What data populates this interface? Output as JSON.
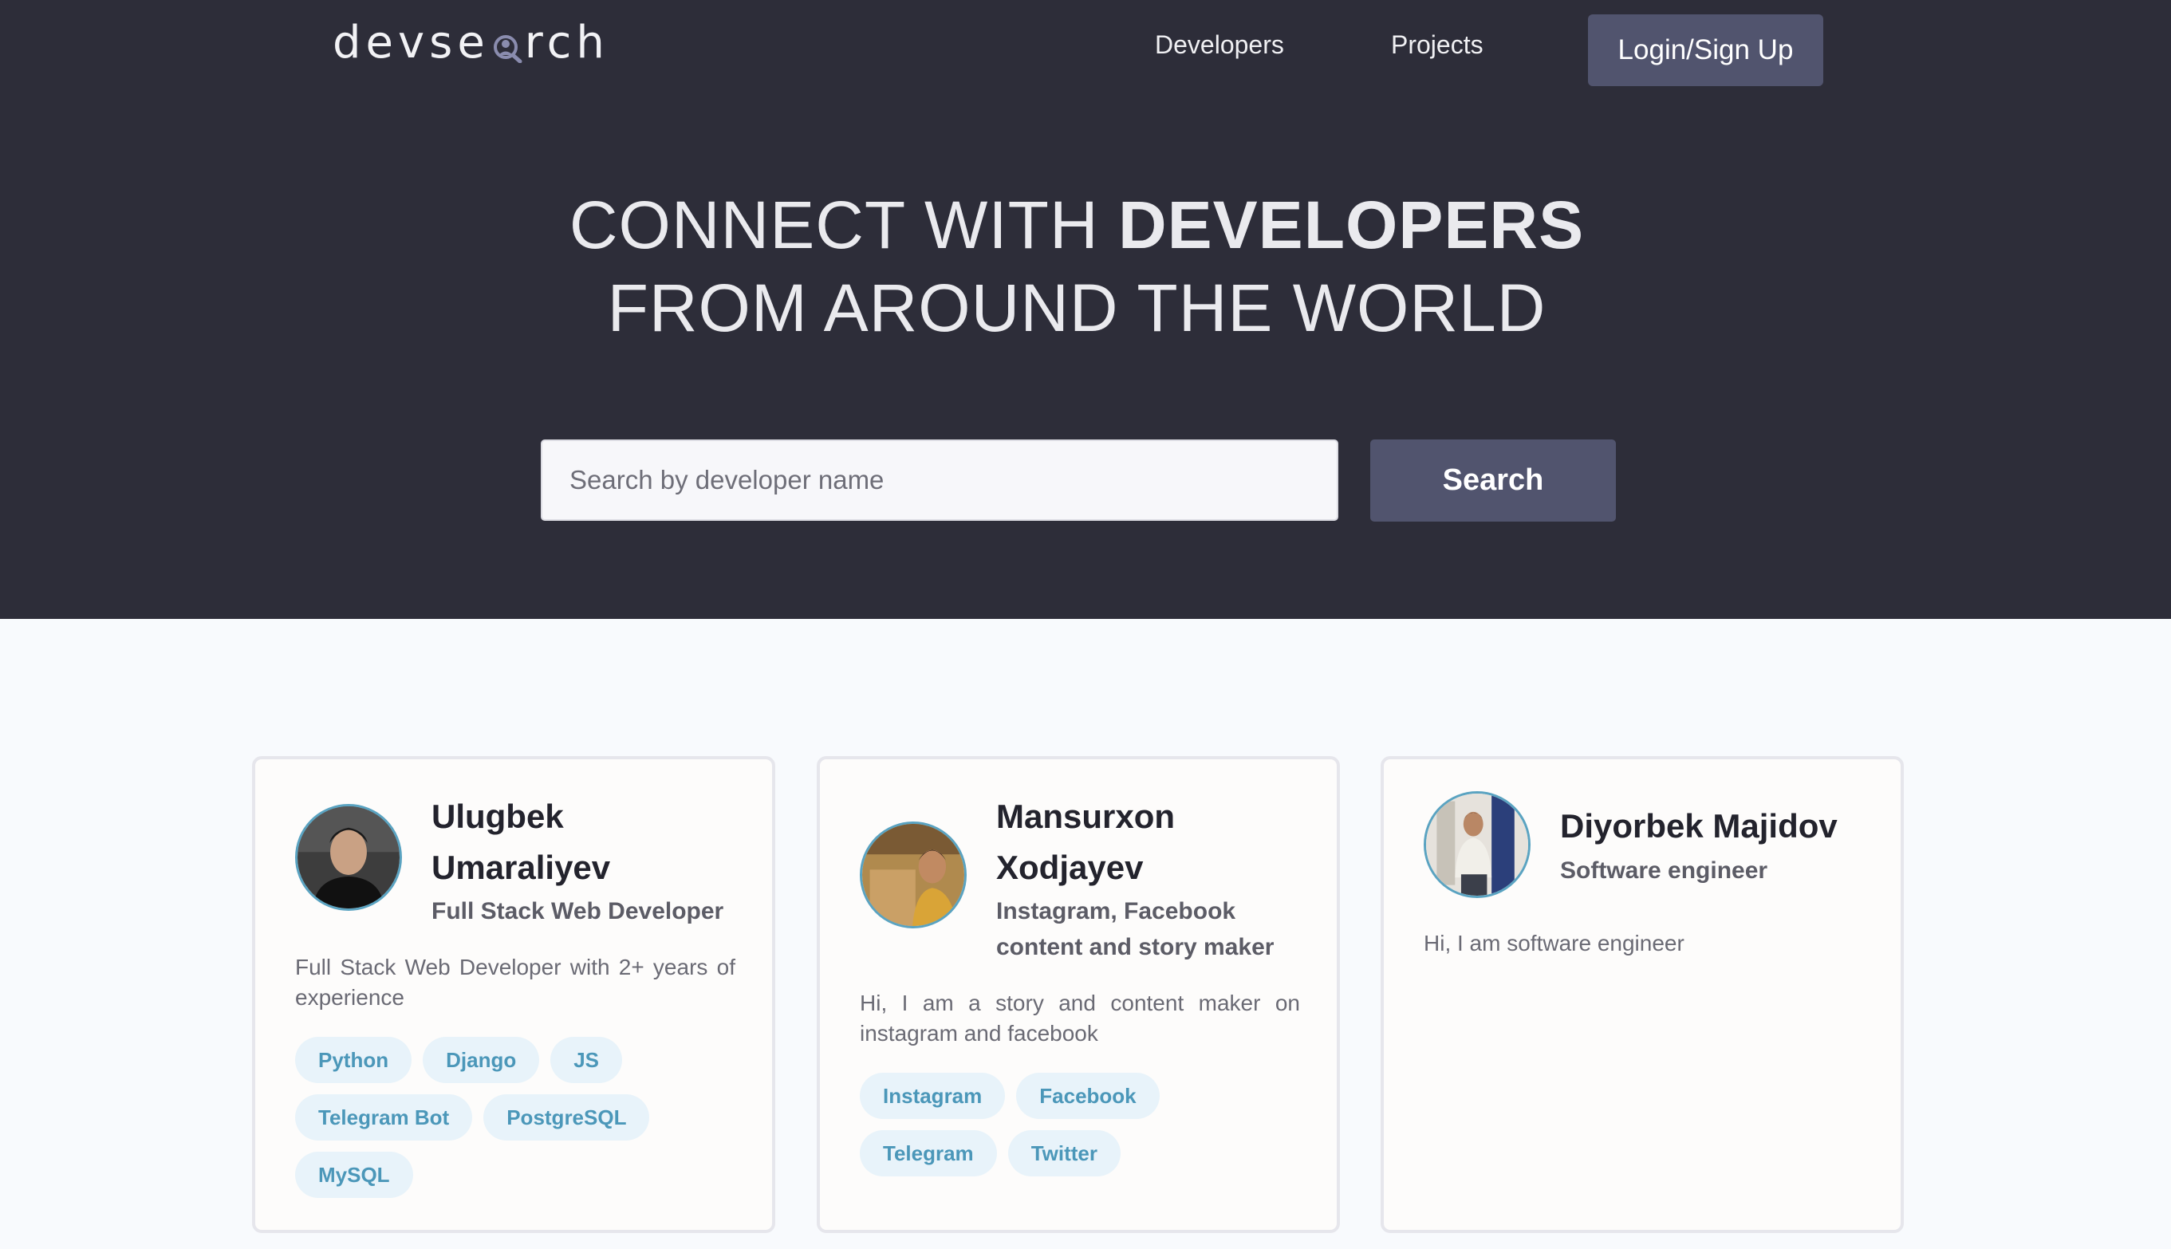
{
  "header": {
    "logo_text_left": "devse",
    "logo_text_right": "rch",
    "nav": {
      "developers": "Developers",
      "projects": "Projects"
    },
    "login_label": "Login/Sign Up"
  },
  "hero": {
    "line1_prefix": "CONNECT WITH ",
    "line1_bold": "DEVELOPERS",
    "line2": "FROM AROUND THE WORLD"
  },
  "search": {
    "placeholder": "Search by developer name",
    "button_label": "Search"
  },
  "developers": [
    {
      "name_line1": "Ulugbek",
      "name_line2": "Umaraliyev",
      "role": "Full Stack Web Developer",
      "bio": "Full Stack Web Developer with 2+ years of experience",
      "skills": [
        "Python",
        "Django",
        "JS",
        "Telegram Bot",
        "PostgreSQL",
        "MySQL"
      ]
    },
    {
      "name_line1": "Mansurxon",
      "name_line2": "Xodjayev",
      "role_line1": "Instagram, Facebook",
      "role_line2": "content and story maker",
      "bio": "Hi, I am a story and content maker on instagram and facebook",
      "skills": [
        "Instagram",
        "Facebook",
        "Telegram",
        "Twitter"
      ]
    },
    {
      "name": "Diyorbek Majidov",
      "role": "Software engineer",
      "bio": "Hi, I am software engineer",
      "skills": []
    }
  ],
  "colors": {
    "hero_bg": "#2d2d39",
    "button_bg": "#51546e",
    "tag_bg": "#e8f3fa",
    "tag_text": "#4b97b9",
    "avatar_ring": "#5aa3c1"
  }
}
